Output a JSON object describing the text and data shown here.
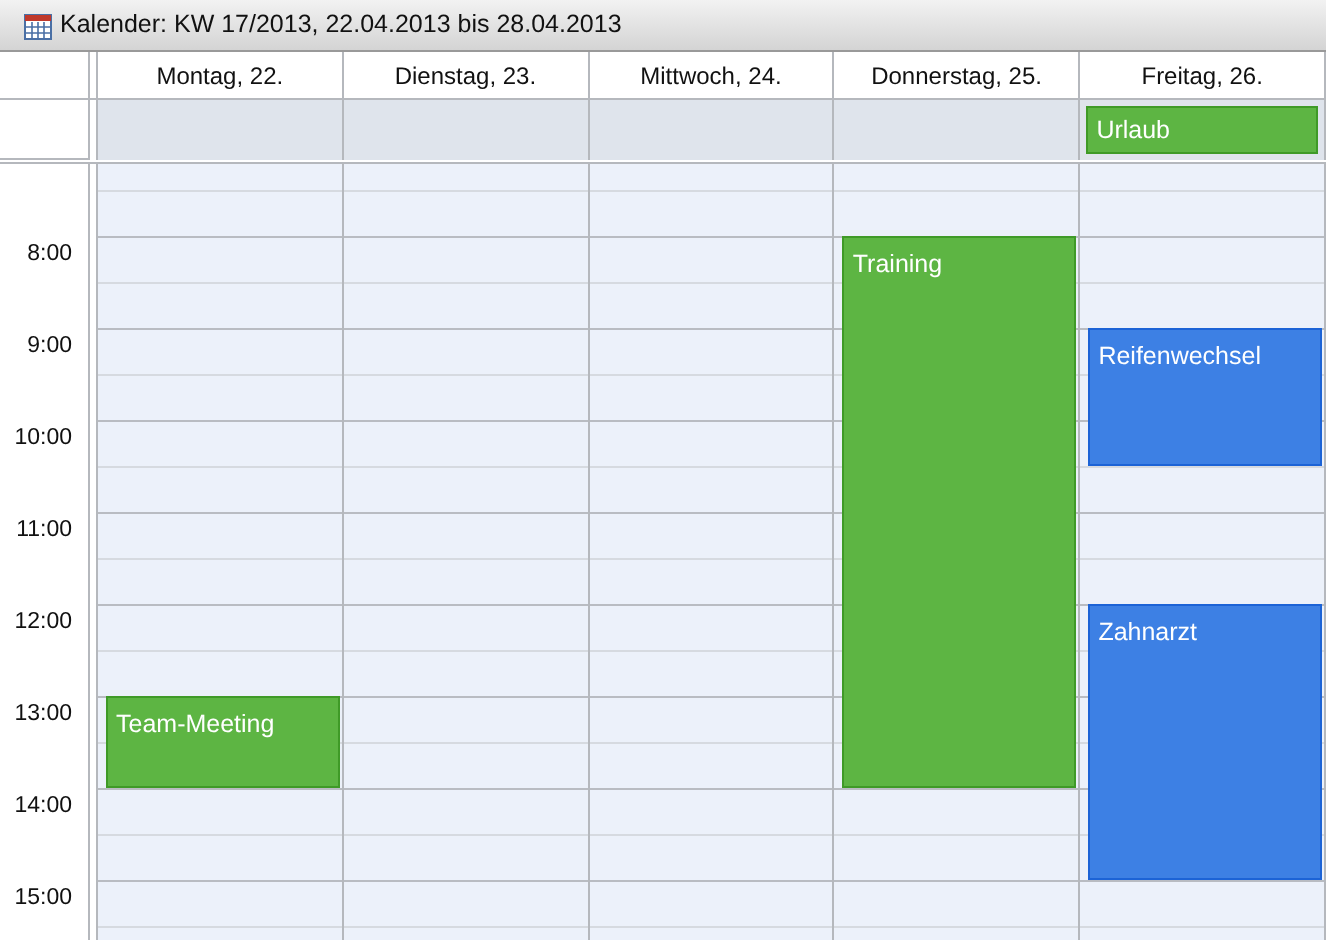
{
  "window": {
    "title": "Kalender: KW 17/2013, 22.04.2013 bis 28.04.2013"
  },
  "days": [
    {
      "label": "Montag, 22.",
      "events": [
        {
          "title": "Team-Meeting",
          "color": "#5db543"
        }
      ]
    },
    {
      "label": "Dienstag, 23."
    },
    {
      "label": "Mittwoch, 24."
    },
    {
      "label": "Donnerstag, 25.",
      "events": [
        {
          "title": "Training",
          "color": "#5db543"
        }
      ]
    },
    {
      "label": "Freitag, 26.",
      "all_day": [
        {
          "title": "Urlaub",
          "color": "#5db543"
        }
      ],
      "events": [
        {
          "title": "Reifenwechsel",
          "color": "#3d80e4"
        },
        {
          "title": "Zahnarzt",
          "color": "#3d80e4"
        }
      ]
    }
  ],
  "hours": [
    "8:00",
    "9:00",
    "10:00",
    "11:00",
    "12:00",
    "13:00",
    "14:00",
    "15:00"
  ]
}
